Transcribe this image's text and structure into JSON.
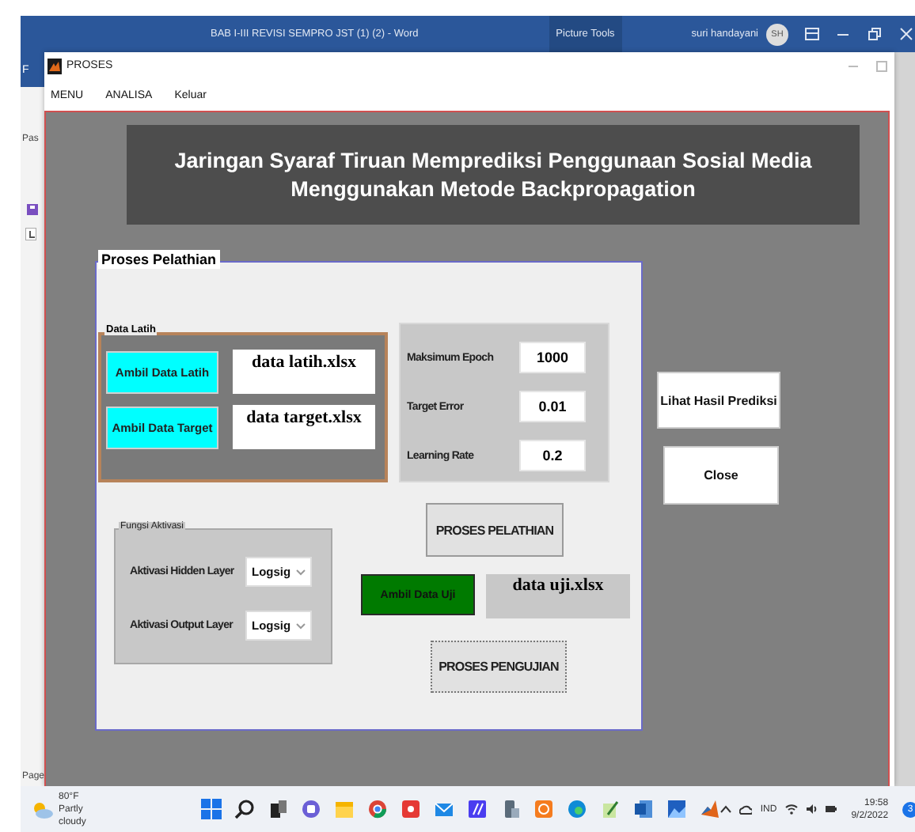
{
  "word_window": {
    "title": "BAB I-III REVISI SEMPRO JST (1) (2)  -  Word",
    "context_tab": "Picture Tools",
    "user": "suri handayani",
    "avatar": "SH",
    "side_texts": [
      "F",
      "Pas",
      "Page"
    ]
  },
  "matlab_window": {
    "title": "PROSES",
    "menu": [
      "MENU",
      "ANALISA",
      "Keluar"
    ],
    "header": [
      "Jaringan Syaraf Tiruan Memprediksi Penggunaan Sosial Media",
      "Menggunakan Metode Backpropagation"
    ],
    "training_panel": {
      "title": "Proses Pelathian",
      "data_latih": {
        "title": "Data Latih",
        "rows": [
          {
            "button": "Ambil Data Latih",
            "file": "data latih.xlsx"
          },
          {
            "button": "Ambil Data Target",
            "file": "data target.xlsx"
          }
        ]
      },
      "parameters": [
        {
          "label": "Maksimum Epoch",
          "value": "1000"
        },
        {
          "label": "Target Error",
          "value": "0.01"
        },
        {
          "label": "Learning Rate",
          "value": "0.2"
        }
      ],
      "activation": {
        "title": "Fungsi Aktivasi",
        "rows": [
          {
            "label": "Aktivasi Hidden Layer",
            "value": "Logsig"
          },
          {
            "label": "Aktivasi Output Layer",
            "value": "Logsig"
          }
        ]
      },
      "train_button": "PROSES PELATHIAN",
      "test_data": {
        "button": "Ambil Data Uji",
        "file": "data uji.xlsx"
      },
      "test_button": "PROSES PENGUJIAN"
    },
    "side_buttons": [
      "Lihat Hasil Prediksi",
      "Close"
    ]
  },
  "taskbar": {
    "weather": {
      "temperature": "80°F",
      "condition": "Partly cloudy"
    },
    "tray": {
      "language": "IND",
      "time": "19:58",
      "date": "9/2/2022",
      "notifications": "3"
    }
  }
}
